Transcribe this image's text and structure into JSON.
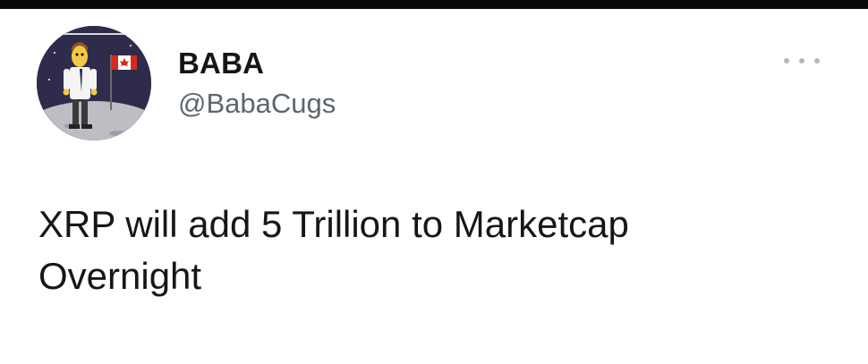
{
  "tweet": {
    "display_name": "BABA",
    "handle": "@BabaCugs",
    "text_lines": [
      "XRP will add 5 Trillion to Marketcap",
      "Overnight"
    ]
  },
  "icons": {
    "avatar": "cartoon-man-with-canadian-flag-avatar",
    "more": "more-options-icon"
  },
  "colors": {
    "text": "#14171a",
    "handle": "#5b6670",
    "more_dots": "#b3bac1",
    "top_bar": "#0a0a0a"
  }
}
